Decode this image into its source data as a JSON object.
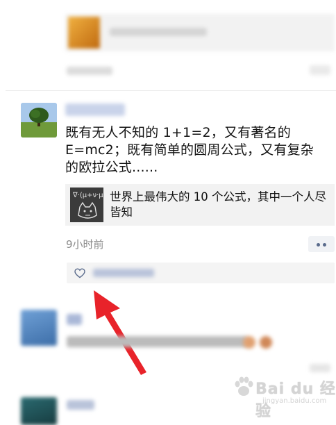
{
  "post": {
    "text_lines": [
      "既有无人不知的 1+1=2，又有著名的",
      "E=mc2；既有简单的圆周公式，又有复杂",
      "的欧拉公式......"
    ],
    "share_card": {
      "title": "世界上最伟大的 10 个公式，其中一个人尽皆知",
      "thumb_formula": "∇·(μ+ν·μ)"
    },
    "time": "9小时前"
  },
  "icons": {
    "like": "heart-icon",
    "more": "more-dots-icon",
    "arrow": "red-arrow-annotation"
  },
  "colors": {
    "link_blue": "#5a6b8c",
    "arrow_red": "#e8232a",
    "time_gray": "#8a8a8a"
  },
  "watermark": {
    "brand": "Bai du 经验",
    "url": "jingyan.baidu.com"
  }
}
